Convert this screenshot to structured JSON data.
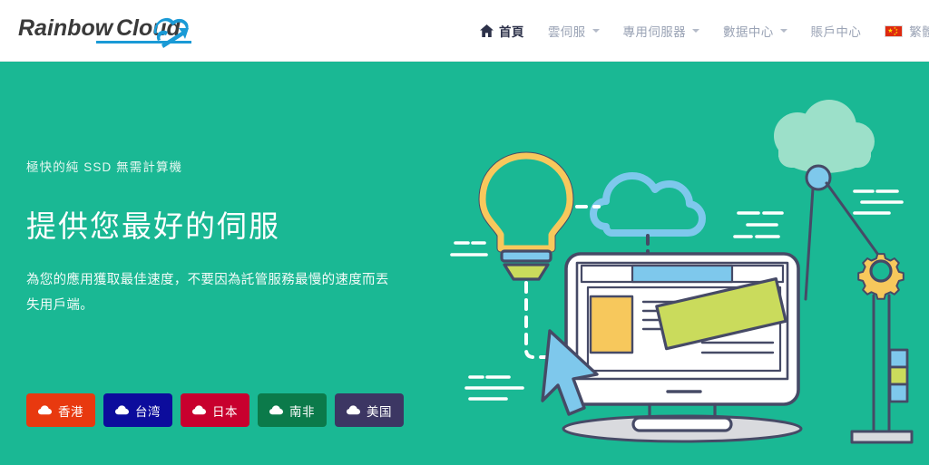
{
  "header": {
    "logo": {
      "text_main": "Rainbow",
      "text_accent": "Cloud",
      "icon": "cloud-arrow-logo"
    },
    "nav": [
      {
        "label": "首頁",
        "icon": "home-icon",
        "active": true,
        "has_dropdown": false
      },
      {
        "label": "雲伺服",
        "icon": "",
        "active": false,
        "has_dropdown": true
      },
      {
        "label": "專用伺服器",
        "icon": "",
        "active": false,
        "has_dropdown": true
      },
      {
        "label": "數据中心",
        "icon": "",
        "active": false,
        "has_dropdown": true
      },
      {
        "label": "賬戶中心",
        "icon": "",
        "active": false,
        "has_dropdown": false
      },
      {
        "label": "繁體中文",
        "icon": "cn-flag-icon",
        "active": false,
        "has_dropdown": false
      }
    ]
  },
  "hero": {
    "eyebrow": "極快的純 SSD 無需計算機",
    "headline": "提供您最好的伺服",
    "subcopy": "為您的應用獲取最佳速度，不要因為託管服務最慢的速度而丟失用戶端。",
    "background_color": "#1ab894",
    "buttons": [
      {
        "label": "香港",
        "color": "#e8390f",
        "icon": "cloud-icon"
      },
      {
        "label": "台湾",
        "color": "#0c0c9c",
        "icon": "cloud-icon"
      },
      {
        "label": "日本",
        "color": "#c8002e",
        "icon": "cloud-icon"
      },
      {
        "label": "南非",
        "color": "#0b7a4a",
        "icon": "cloud-icon"
      },
      {
        "label": "美国",
        "color": "#3c3663",
        "icon": "cloud-icon"
      }
    ],
    "illustration": {
      "name": "cloud-hosting-illustration",
      "elements": [
        "background-cloud",
        "lightbulb",
        "outline-cloud",
        "desktop-monitor",
        "mouse-cursor",
        "crane-gear",
        "dashed-connectors",
        "speed-lines"
      ],
      "colors": {
        "stroke": "#464a66",
        "yellow": "#f7c85c",
        "lime": "#cadb5c",
        "blue": "#7ec8ec",
        "white": "#ffffff",
        "mint": "#9ce0c9",
        "gray": "#d9dade"
      }
    }
  }
}
